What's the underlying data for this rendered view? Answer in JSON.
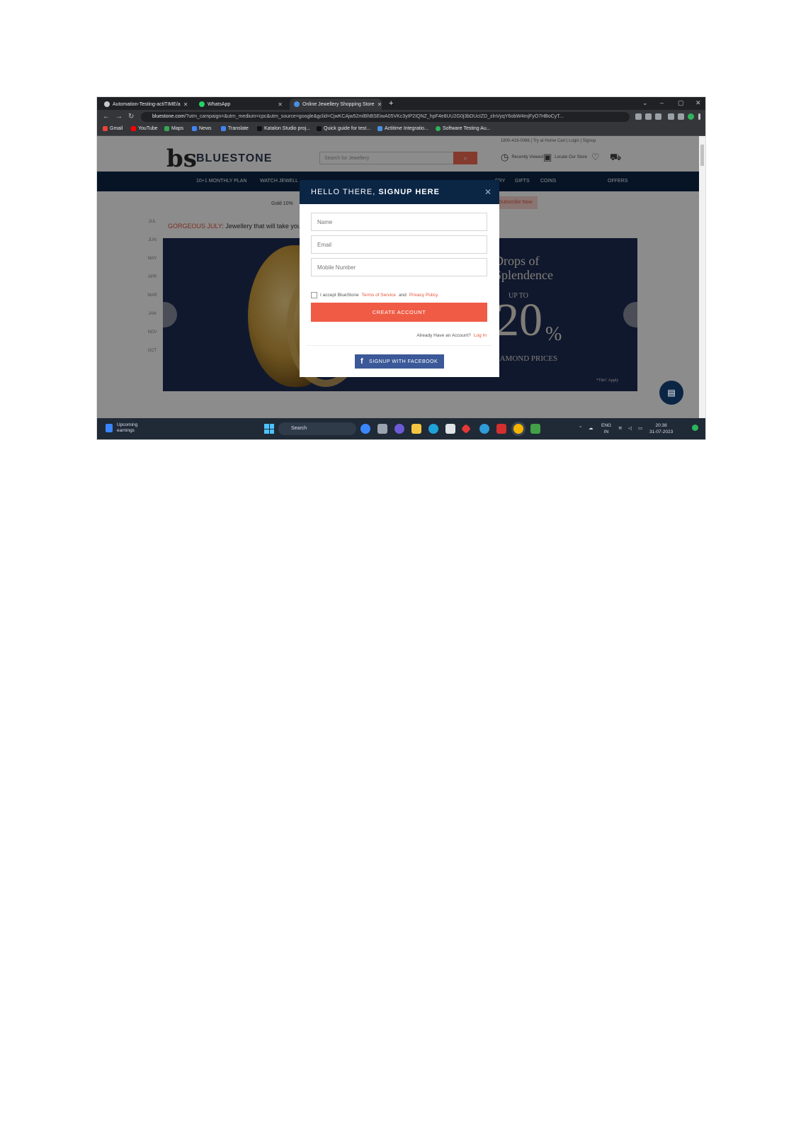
{
  "browser": {
    "tabs": [
      {
        "title": "Automation-Testing-actiTIME/a",
        "color": "#c9c9c9"
      },
      {
        "title": "WhatsApp",
        "color": "#25d366"
      },
      {
        "title": "Online Jewellery Shopping Store",
        "color": "#4a90e2"
      }
    ],
    "url_host": "bluestone.com",
    "url_rest": "/?utm_campaign=&utm_medium=cpc&utm_source=google&gclid=CjwKCAjw52mlBhBSEiwA05VKc3yIP2IQNZ_hpF4e8UU2G0j3bDUcIZD_zlnVyqY6obW4mjFyO7HBoCyT...",
    "bookmarks": [
      {
        "label": "Gmail",
        "color": "#ea4335"
      },
      {
        "label": "YouTube",
        "color": "#ff0000"
      },
      {
        "label": "Maps",
        "color": "#34a853"
      },
      {
        "label": "News",
        "color": "#4285f4"
      },
      {
        "label": "Translate",
        "color": "#4285f4"
      },
      {
        "label": "Katalon Studio proj...",
        "color": "#1f1f1f"
      },
      {
        "label": "Quick guide for test...",
        "color": "#1f1f1f"
      },
      {
        "label": "Actitime Integratio...",
        "color": "#4a90e2"
      },
      {
        "label": "Software Testing Au...",
        "color": "#2db55d"
      }
    ]
  },
  "site": {
    "brand": "BLUESTONE",
    "logo_mark": "bs",
    "topline": "1800-419-0066  |  Try at Home Cart  |  Login  |  Signup",
    "search_placeholder": "Search for Jewellery",
    "header_icons": {
      "recent": "Recently Viewed",
      "store": "Locate Our Store"
    },
    "nav": [
      "10+1 MONTHLY PLAN",
      "WATCH JEWELL",
      "ERY",
      "GIFTS",
      "COINS",
      "OFFERS"
    ],
    "offer_text": "Gold 10%",
    "offer_pill": "Subscribe Now",
    "months": [
      "JUL",
      "JUN",
      "MAY",
      "APR",
      "MAR",
      "JAN",
      "NOV",
      "OCT"
    ],
    "gorgeous_lead": "GORGEOUS JULY",
    "gorgeous_rest": ": Jewellery that will take you",
    "banner": {
      "line1": "Drops of",
      "line2": "Splendence",
      "upto": "UP TO",
      "big": "20",
      "pct": "%",
      "sub": "DIAMOND PRICES",
      "tc": "*T&C Apply"
    }
  },
  "modal": {
    "title_lead": "HELLO THERE, ",
    "title_bold": "SIGNUP HERE",
    "name_placeholder": "Name",
    "email_placeholder": "Email",
    "mobile_placeholder": "Mobile Number",
    "terms_prefix": "I accept BlueStone",
    "terms_link1": "Terms of Service",
    "terms_and": "and",
    "terms_link2": "Privacy Policy.",
    "create_label": "CREATE ACCOUNT",
    "already_text": "Already Have an Account?",
    "login_link": "Log In",
    "facebook_label": "SIGNUP WITH FACEBOOK"
  },
  "taskbar": {
    "weather_line1": "Upcoming",
    "weather_line2": "earnings",
    "search": "Search",
    "lang1": "ENG",
    "lang2": "IN",
    "time": "20:38",
    "date": "31-07-2023"
  }
}
